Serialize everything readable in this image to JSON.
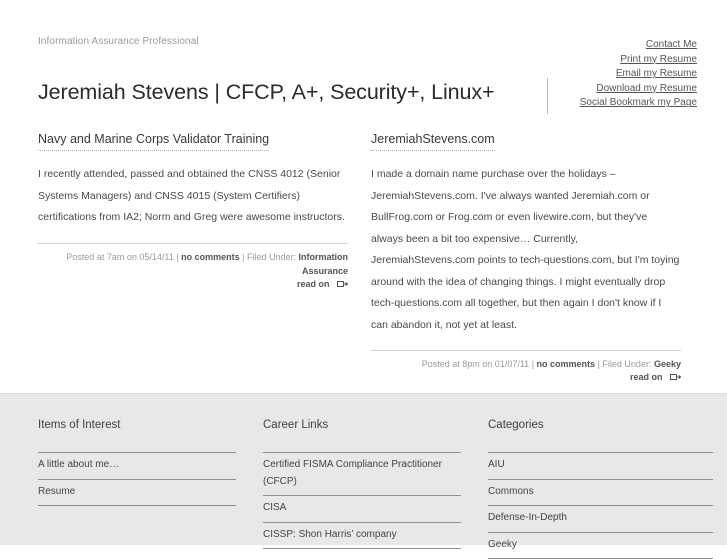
{
  "header": {
    "tagline": "Information Assurance Professional",
    "nav": [
      {
        "label": "Contact Me"
      },
      {
        "label": "Print my Resume"
      },
      {
        "label": "Email my Resume"
      },
      {
        "label": "Download my Resume"
      },
      {
        "label": "Social Bookmark my Page"
      }
    ]
  },
  "site": {
    "title": "Jeremiah Stevens | CFCP, A+, Security+, Linux+"
  },
  "posts": [
    {
      "title": "Navy and Marine Corps Validator Training",
      "body": "I recently attended, passed and obtained the CNSS 4012 (Senior Systems Managers) and CNSS 4015 (System Certifiers) certifications from IA2;  Norm and Greg were awesome instructors.",
      "meta_posted": "Posted at 7am on 05/14/11",
      "meta_comments": "no comments",
      "meta_filed_label": "Filed Under:",
      "meta_category": "Information Assurance",
      "read_on": "read on",
      "read_on_icon": "box-arrow-icon"
    },
    {
      "title": "JeremiahStevens.com",
      "body": "I made a domain name purchase over the holidays – JeremiahStevens.com.  I've always wanted Jeremiah.com or BullFrog.com or Frog.com or even livewire.com, but they've always been a bit too expensive…  Currently, JeremiahStevens.com points to tech-questions.com, but I'm toying around with the idea of changing things.  I might eventually drop tech-questions.com all together, but then again I don't know if I can abandon it, not yet at least.",
      "meta_posted": "Posted at 8pm on 01/07/11",
      "meta_comments": "no comments",
      "meta_filed_label": "Filed Under:",
      "meta_category": "Geeky",
      "read_on": "read on",
      "read_on_icon": "box-arrow-icon"
    }
  ],
  "footer": {
    "columns": [
      {
        "title": "Items of Interest",
        "items": [
          {
            "label": "A little about me…"
          },
          {
            "label": "Resume"
          }
        ]
      },
      {
        "title": "Career Links",
        "items": [
          {
            "label": "Certified FISMA Compliance Practitioner (CFCP)"
          },
          {
            "label": "CISA"
          },
          {
            "label": "CISSP: Shon Harris’ company"
          }
        ]
      },
      {
        "title": "Categories",
        "items": [
          {
            "label": "AIU"
          },
          {
            "label": "Commons"
          },
          {
            "label": "Defense-In-Depth"
          },
          {
            "label": "Geeky"
          }
        ]
      }
    ]
  },
  "colors": {
    "footer_bg": "#e8e8e8",
    "text": "#333333",
    "muted": "#9a9a9a",
    "rule": "#8f8f8f"
  }
}
